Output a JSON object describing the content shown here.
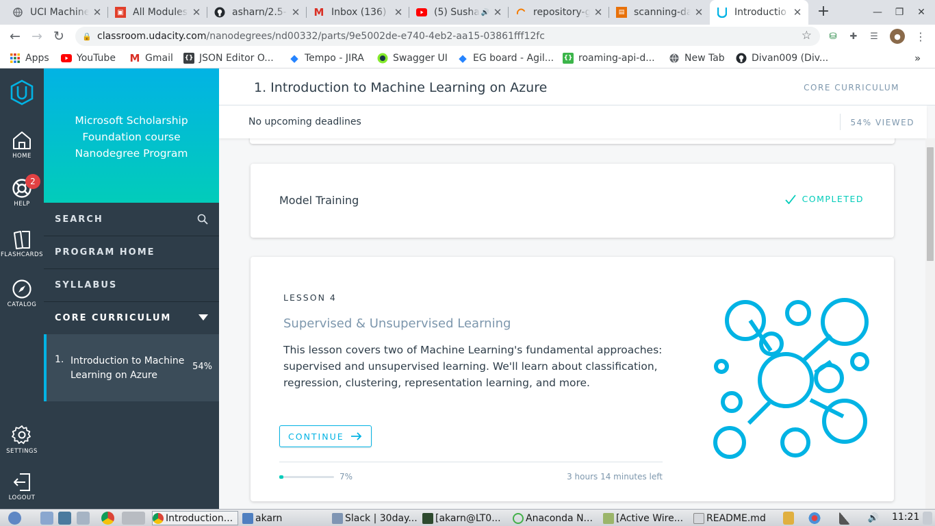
{
  "browser": {
    "tabs": [
      {
        "title": "UCI Machine",
        "icon": "globe-icon",
        "color": "#5f6368"
      },
      {
        "title": "All Modules",
        "icon": "canvas-icon",
        "color": "#e13f2b"
      },
      {
        "title": "asharn/2.5-n",
        "icon": "github-icon",
        "color": "#24292e"
      },
      {
        "title": "Inbox (136) -",
        "icon": "gmail-icon",
        "color": "#d93025"
      },
      {
        "title": "(5) Susha",
        "icon": "youtube-icon",
        "color": "#ff0000"
      },
      {
        "title": "repository-g",
        "icon": "spinner-icon",
        "color": "#f57c00"
      },
      {
        "title": "scanning-da",
        "icon": "doc-icon",
        "color": "#e8710a"
      },
      {
        "title": "Introductio",
        "icon": "udacity-icon",
        "color": "#02b3e4"
      }
    ],
    "url_host": "classroom.udacity.com",
    "url_path": "/nanodegrees/nd00332/parts/9e5002de-e740-4eb2-aa15-03861fff12fc",
    "bookmarks": [
      {
        "label": "Apps",
        "icon": "apps-grid-icon"
      },
      {
        "label": "YouTube",
        "icon": "youtube-icon"
      },
      {
        "label": "Gmail",
        "icon": "gmail-icon"
      },
      {
        "label": "JSON Editor O...",
        "icon": "json-icon"
      },
      {
        "label": "Tempo - JIRA",
        "icon": "jira-icon"
      },
      {
        "label": "Swagger UI",
        "icon": "swagger-icon"
      },
      {
        "label": "EG board - Agil...",
        "icon": "jira-icon"
      },
      {
        "label": "roaming-api-d...",
        "icon": "api-icon"
      },
      {
        "label": "New Tab",
        "icon": "globe-icon"
      },
      {
        "label": "Divan009 (Div...",
        "icon": "github-icon"
      }
    ]
  },
  "rail": {
    "home": "HOME",
    "help": "HELP",
    "help_badge": "2",
    "flashcards": "FLASHCARDS",
    "catalog": "CATALOG",
    "settings": "SETTINGS",
    "logout": "LOGOUT"
  },
  "sidebar": {
    "program_title": "Microsoft Scholarship Foundation course Nanodegree Program",
    "search": "SEARCH",
    "program_home": "PROGRAM HOME",
    "syllabus": "SYLLABUS",
    "core_curriculum": "CORE CURRICULUM",
    "lesson_num": "1.",
    "lesson_name": "Introduction to Machine Learning on Azure",
    "lesson_pct": "54%"
  },
  "header": {
    "title": "1. Introduction to Machine Learning on Azure",
    "section": "CORE CURRICULUM",
    "deadlines": "No upcoming deadlines",
    "viewed": "54% VIEWED"
  },
  "cards": {
    "model_training": {
      "title": "Model Training",
      "status": "COMPLETED"
    },
    "lesson4": {
      "kicker": "LESSON 4",
      "title": "Supervised & Unsupervised Learning",
      "description": "This lesson covers two of Machine Learning's fundamental approaches: supervised and unsupervised learning. We'll learn about classification, regression, clustering, representation learning, and more.",
      "cta": "CONTINUE",
      "progress": 0.07,
      "progress_label": "7%",
      "time_left": "3 hours 14 minutes left"
    }
  },
  "colors": {
    "udacity_blue": "#02b3e4",
    "udacity_teal": "#02ccba",
    "sidebar_dark": "#2e3d49",
    "badge_red": "#e24143"
  },
  "taskbar": {
    "items": [
      {
        "label": "Introduction...",
        "icon": "chrome-icon"
      },
      {
        "label": "akarn",
        "icon": "folder-icon"
      },
      {
        "label": "Slack | 30day...",
        "icon": "window-icon"
      },
      {
        "label": "[akarn@LT0...",
        "icon": "terminal-icon"
      },
      {
        "label": "Anaconda N...",
        "icon": "anaconda-icon"
      },
      {
        "label": "[Active Wire...",
        "icon": "doc-icon"
      },
      {
        "label": "README.md",
        "icon": "doc-icon"
      }
    ],
    "clock": "11:21"
  }
}
